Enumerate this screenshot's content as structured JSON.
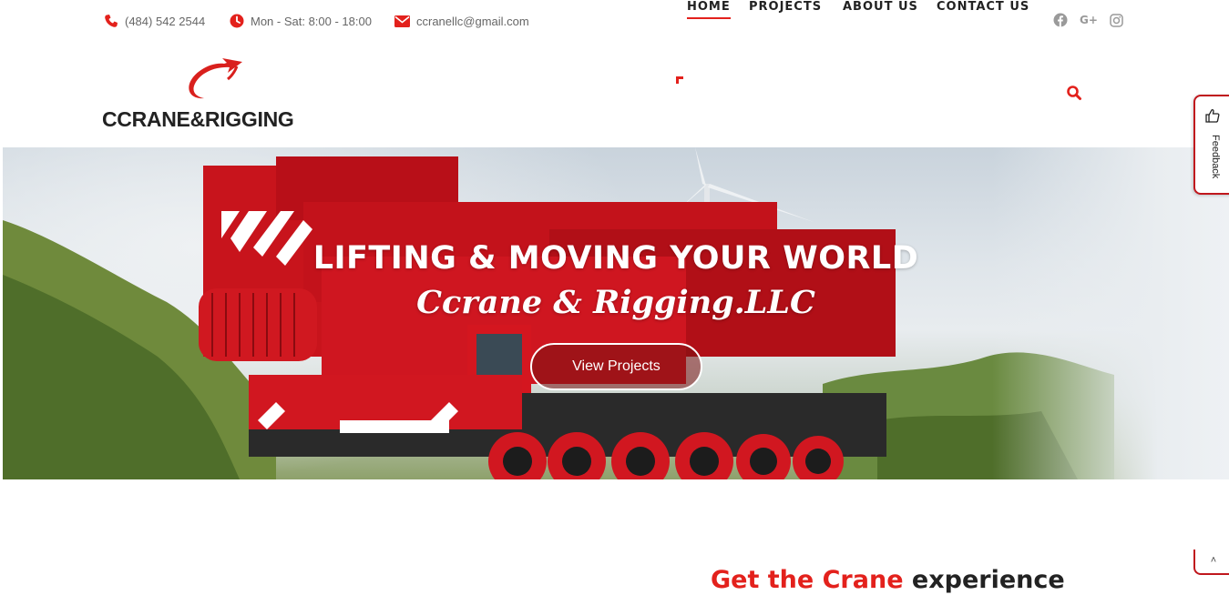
{
  "topbar": {
    "phone": "(484) 542 2544",
    "hours": "Mon - Sat: 8:00 - 18:00",
    "email": "ccranellc@gmail.com",
    "social": [
      "facebook-icon",
      "google-plus-icon",
      "instagram-icon"
    ],
    "google_plus_label": "G+"
  },
  "brand": {
    "logo_text": "CCRANE&RIGGING"
  },
  "nav": {
    "items": [
      {
        "label": "HOME",
        "active": true
      },
      {
        "label": "PROJECTS",
        "active": false
      },
      {
        "label": "ABOUT US",
        "active": false
      },
      {
        "label": "CONTACT US",
        "active": false
      }
    ],
    "search_icon": "search-icon"
  },
  "hero": {
    "title": "LIFTING & MOVING YOUR WORLD",
    "subtitle": "Ccrane & Rigging.LLC",
    "button_label": "View Projects"
  },
  "feedback": {
    "label": "Feedback",
    "icon": "thumbs-up-icon"
  },
  "scroll_top": {
    "icon": "chevron-up-icon",
    "label": "˄"
  },
  "section": {
    "heading_accent": "Get the Crane",
    "heading_rest": " experience"
  },
  "colors": {
    "accent": "#e3211c",
    "hero_button_border": "#ffffff",
    "feedback_border": "#c0171d"
  }
}
